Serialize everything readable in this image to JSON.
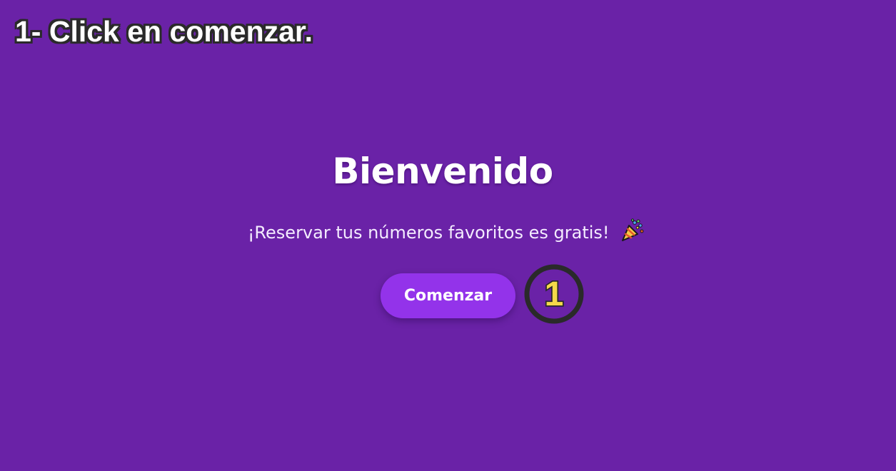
{
  "tutorial": {
    "instruction": "1- Click en comenzar.",
    "step_marker": "1",
    "marker_color": "#f5d94a",
    "outline_color": "#2a2a2a"
  },
  "welcome": {
    "title": "Bienvenido",
    "subtitle": "¡Reservar tus números favoritos es gratis!",
    "emoji_icon": "party-popper-icon",
    "start_button_label": "Comenzar"
  },
  "colors": {
    "background": "#6a22a7",
    "button": "#9333ea",
    "text": "#ffffff"
  }
}
